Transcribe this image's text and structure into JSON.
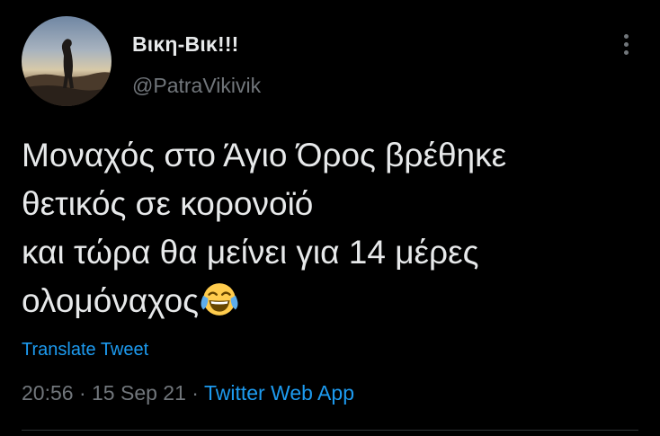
{
  "user": {
    "display_name": "Βικη-Βικ!!!",
    "handle": "@PatraVikivik"
  },
  "tweet": {
    "lines": [
      "Μοναχός στο Άγιο Όρος βρέθηκε",
      "θετικός σε κορονοϊό",
      "και τώρα θα μείνει για 14 μέρες",
      "ολομόναχος"
    ],
    "emoji": "face-with-tears-of-joy"
  },
  "actions": {
    "translate_label": "Translate Tweet"
  },
  "meta": {
    "time": "20:56",
    "separator": "·",
    "date": "15 Sep 21",
    "app": "Twitter Web App"
  },
  "icons": {
    "more": "more-options-icon"
  },
  "colors": {
    "background": "#000000",
    "text": "#e7e9ea",
    "secondary": "#71767b",
    "link": "#1d9bf0"
  }
}
